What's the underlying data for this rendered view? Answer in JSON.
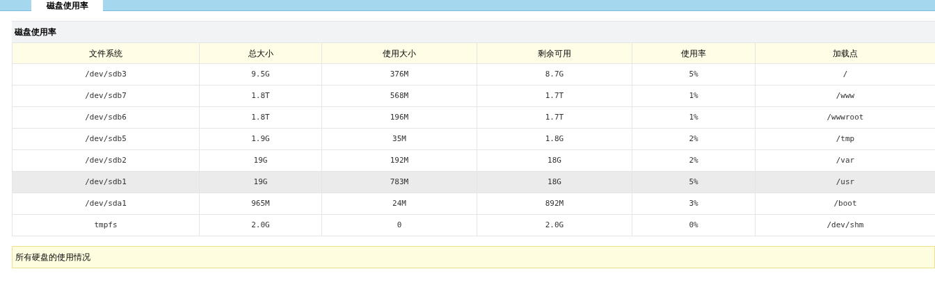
{
  "tab": {
    "label": "磁盘使用率",
    "selected": true
  },
  "panel": {
    "title": "磁盘使用率"
  },
  "table": {
    "columns": [
      "文件系统",
      "总大小",
      "使用大小",
      "剩余可用",
      "使用率",
      "加载点"
    ],
    "rows": [
      {
        "cells": [
          "/dev/sdb3",
          "9.5G",
          "376M",
          "8.7G",
          "5%",
          "/"
        ],
        "selected": false
      },
      {
        "cells": [
          "/dev/sdb7",
          "1.8T",
          "568M",
          "1.7T",
          "1%",
          "/www"
        ],
        "selected": false
      },
      {
        "cells": [
          "/dev/sdb6",
          "1.8T",
          "196M",
          "1.7T",
          "1%",
          "/wwwroot"
        ],
        "selected": false
      },
      {
        "cells": [
          "/dev/sdb5",
          "1.9G",
          "35M",
          "1.8G",
          "2%",
          "/tmp"
        ],
        "selected": false
      },
      {
        "cells": [
          "/dev/sdb2",
          "19G",
          "192M",
          "18G",
          "2%",
          "/var"
        ],
        "selected": false
      },
      {
        "cells": [
          "/dev/sdb1",
          "19G",
          "783M",
          "18G",
          "5%",
          "/usr"
        ],
        "selected": true
      },
      {
        "cells": [
          "/dev/sda1",
          "965M",
          "24M",
          "892M",
          "3%",
          "/boot"
        ],
        "selected": false
      },
      {
        "cells": [
          "tmpfs",
          "2.0G",
          "0",
          "2.0G",
          "0%",
          "/dev/shm"
        ],
        "selected": false
      }
    ]
  },
  "note": "所有硬盘的使用情况"
}
